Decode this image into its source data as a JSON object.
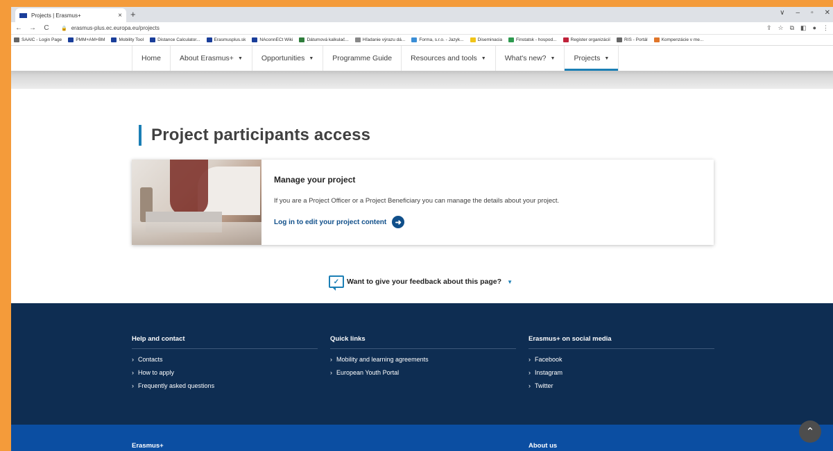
{
  "browser": {
    "tab_title": "Projects | Erasmus+",
    "tab_close": "×",
    "new_tab": "+",
    "window_controls": [
      "∨",
      "–",
      "▫",
      "✕"
    ],
    "url": "erasmus-plus.ec.europa.eu/projects",
    "nav_buttons": [
      "←",
      "→",
      "C"
    ],
    "right_icons": [
      "⇪",
      "☆",
      "⧉",
      "◧",
      "●",
      "⋮"
    ],
    "bookmarks": [
      {
        "label": "SAAIC - Login Page",
        "color": "#666666"
      },
      {
        "label": "PMM+AM+BM",
        "color": "#1a3e9a"
      },
      {
        "label": "Mobility Tool",
        "color": "#1a3e9a"
      },
      {
        "label": "Distance Calculator...",
        "color": "#1a3e9a"
      },
      {
        "label": "Erasmusplus.sk",
        "color": "#1a3e9a"
      },
      {
        "label": "NAconnECt Wiki",
        "color": "#1a3e9a"
      },
      {
        "label": "Dátumová kalkulač...",
        "color": "#2f7d3c"
      },
      {
        "label": "Hľadanie výrazu dá...",
        "color": "#888888"
      },
      {
        "label": "Forma, s.r.o. - Jazyk...",
        "color": "#3a8ed6"
      },
      {
        "label": "Diseminacia",
        "color": "#f0c419"
      },
      {
        "label": "Finstatsk - hospod...",
        "color": "#2e9a4f"
      },
      {
        "label": "Register organizácií",
        "color": "#c0223a"
      },
      {
        "label": "RIS - Portál",
        "color": "#666666"
      },
      {
        "label": "Kompenzácie v me...",
        "color": "#e0762a"
      }
    ]
  },
  "nav": {
    "items": [
      {
        "label": "Home",
        "caret": ""
      },
      {
        "label": "About Erasmus+",
        "caret": "▼"
      },
      {
        "label": "Opportunities",
        "caret": "▼"
      },
      {
        "label": "Programme Guide",
        "caret": ""
      },
      {
        "label": "Resources and tools",
        "caret": "▼"
      },
      {
        "label": "What's new?",
        "caret": "▼"
      },
      {
        "label": "Projects",
        "caret": "▼"
      }
    ]
  },
  "page": {
    "title": "Project participants access"
  },
  "card": {
    "title": "Manage your project",
    "text": "If you are a Project Officer or a Project Beneficiary you can manage the details about your project.",
    "link": "Log in to edit your project content",
    "arrow": "➜"
  },
  "feedback": {
    "label": "Want to give your feedback about this page?",
    "icon_glyph": "✓",
    "caret": "▼"
  },
  "footer": {
    "chevron": "›",
    "columns": [
      {
        "heading": "Help and contact",
        "links": [
          "Contacts",
          "How to apply",
          "Frequently asked questions"
        ]
      },
      {
        "heading": "Quick links",
        "links": [
          "Mobility and learning agreements",
          "European Youth Portal"
        ]
      },
      {
        "heading": "Erasmus+ on social media",
        "links": [
          "Facebook",
          "Instagram",
          "Twitter"
        ]
      }
    ],
    "bottom_left": "Erasmus+",
    "bottom_right": "About us",
    "back_to_top": "⌃"
  },
  "colors": {
    "accent": "#1b7fb5",
    "link": "#104f8a",
    "footer_dark": "#0e2d52",
    "footer_blue": "#0b4ea2",
    "frame": "#f49b3a"
  }
}
